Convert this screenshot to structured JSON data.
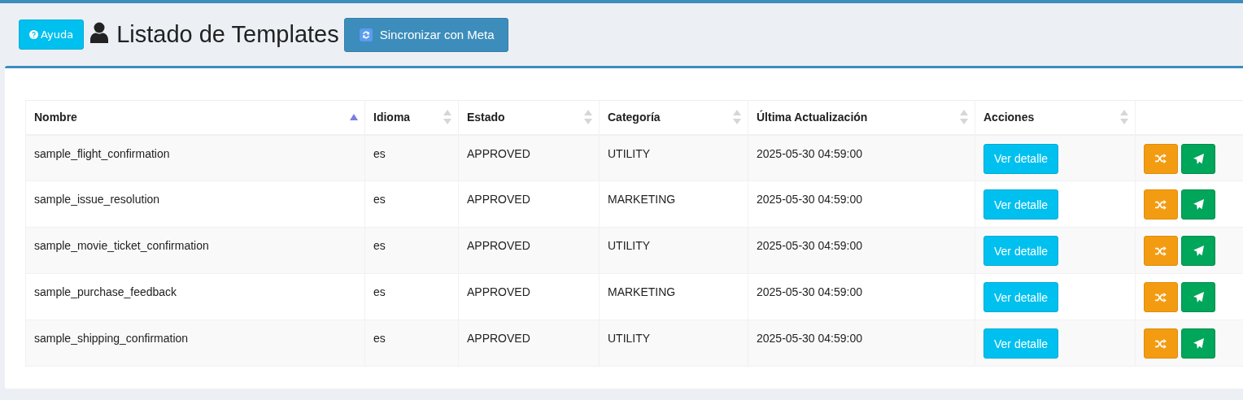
{
  "header": {
    "help_button": "Ayuda",
    "title": "Listado de Templates",
    "sync_button": "Sincronizar con Meta"
  },
  "table": {
    "columns": [
      {
        "label": "Nombre",
        "sorted": true
      },
      {
        "label": "Idioma",
        "sorted": false
      },
      {
        "label": "Estado",
        "sorted": false
      },
      {
        "label": "Categoría",
        "sorted": false
      },
      {
        "label": "Última Actualización",
        "sorted": false
      },
      {
        "label": "Acciones",
        "sorted": false
      }
    ],
    "rows": [
      {
        "name": "sample_flight_confirmation",
        "language": "es",
        "status": "APPROVED",
        "category": "UTILITY",
        "updated": "2025-05-30 04:59:00",
        "action": "Ver detalle"
      },
      {
        "name": "sample_issue_resolution",
        "language": "es",
        "status": "APPROVED",
        "category": "MARKETING",
        "updated": "2025-05-30 04:59:00",
        "action": "Ver detalle"
      },
      {
        "name": "sample_movie_ticket_confirmation",
        "language": "es",
        "status": "APPROVED",
        "category": "UTILITY",
        "updated": "2025-05-30 04:59:00",
        "action": "Ver detalle"
      },
      {
        "name": "sample_purchase_feedback",
        "language": "es",
        "status": "APPROVED",
        "category": "MARKETING",
        "updated": "2025-05-30 04:59:00",
        "action": "Ver detalle"
      },
      {
        "name": "sample_shipping_confirmation",
        "language": "es",
        "status": "APPROVED",
        "category": "UTILITY",
        "updated": "2025-05-30 04:59:00",
        "action": "Ver detalle"
      }
    ]
  }
}
